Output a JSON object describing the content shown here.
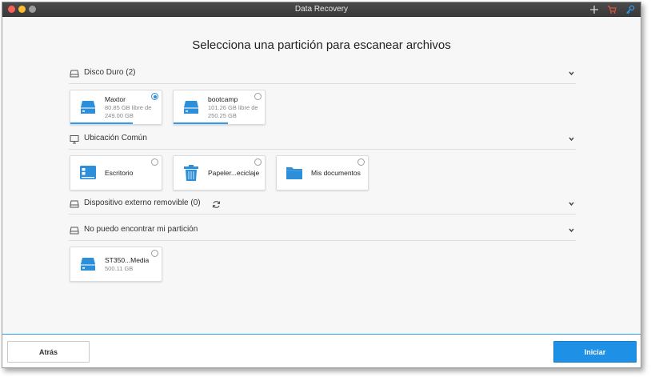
{
  "window": {
    "title": "Data Recovery",
    "toolbar_icons": [
      "plus-icon",
      "cart-icon",
      "key-icon"
    ]
  },
  "heading": "Selecciona una partición para escanear archivos",
  "sections": {
    "hard_disk": {
      "label": "Disco Duro (2)",
      "icon": "hard-disk-icon",
      "items": [
        {
          "name": "Maxtor",
          "sub_line1": "80.85 GB libre de",
          "sub_line2": "249.00 GB",
          "selected": true,
          "used_fraction": 0.68
        },
        {
          "name": "bootcamp",
          "sub_line1": "101.26 GB libre de",
          "sub_line2": "250.25 GB",
          "selected": false,
          "used_fraction": 0.6
        }
      ]
    },
    "common_location": {
      "label": "Ubicación Común",
      "icon": "monitor-icon",
      "items": [
        {
          "name": "Escritorio",
          "icon": "desktop-icon",
          "selected": false
        },
        {
          "name": "Papeler...eciclaje",
          "icon": "trash-icon",
          "selected": false
        },
        {
          "name": "Mis documentos",
          "icon": "folder-icon",
          "selected": false
        }
      ]
    },
    "external": {
      "label": "Dispositivo externo removible (0)",
      "icon": "hard-disk-icon"
    },
    "lost_partition": {
      "label": "No puedo encontrar mi partición",
      "icon": "hard-disk-icon",
      "items": [
        {
          "name": "ST350...Media",
          "sub_line1": "500.11 GB",
          "selected": false
        }
      ]
    }
  },
  "footer": {
    "back_label": "Atrás",
    "start_label": "Iniciar"
  },
  "colors": {
    "accent": "#1e90e6",
    "drive_icon": "#2d8fd9"
  }
}
